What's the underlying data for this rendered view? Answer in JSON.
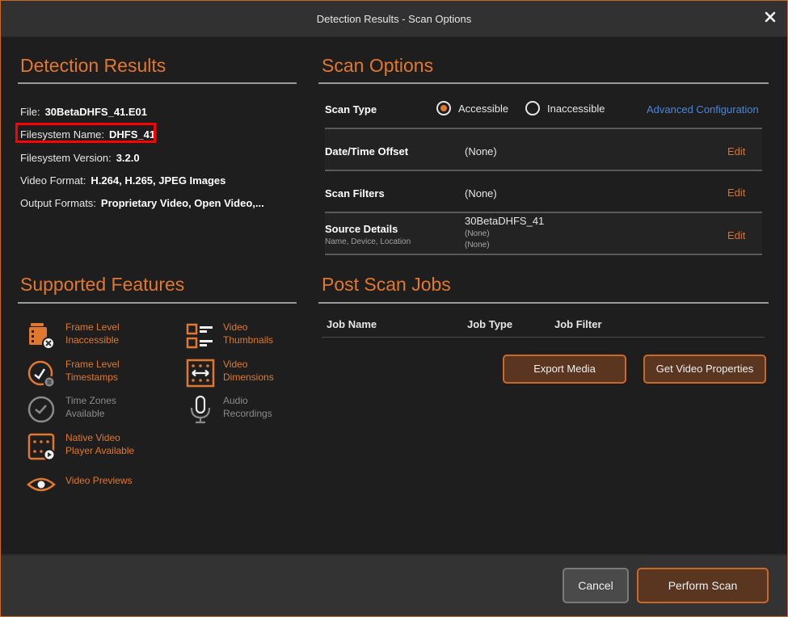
{
  "window": {
    "title": "Detection Results - Scan Options",
    "close_icon": "close-icon"
  },
  "colors": {
    "accent": "#e0782f",
    "link": "#4b86d6",
    "highlight": "#ff0000",
    "button_fill": "#5a3520"
  },
  "detection_results": {
    "title": "Detection Results",
    "fields": [
      {
        "label": "File:",
        "value": "30BetaDHFS_41.E01"
      },
      {
        "label": "Filesystem Name:",
        "value": "DHFS_41"
      },
      {
        "label": "Filesystem Version:",
        "value": "3.2.0"
      },
      {
        "label": "Video Format:",
        "value": "H.264, H.265, JPEG Images"
      },
      {
        "label": "Output Formats:",
        "value": "Proprietary Video, Open Video,..."
      }
    ]
  },
  "supported_features": {
    "title": "Supported Features",
    "items": [
      {
        "line1": "Frame Level",
        "line2": "Inaccessible",
        "icon": "film-inaccessible-icon",
        "enabled": true
      },
      {
        "line1": "Video",
        "line2": "Thumbnails",
        "icon": "thumbnails-icon",
        "enabled": true
      },
      {
        "line1": "Frame Level",
        "line2": "Timestamps",
        "icon": "clock-timestamp-icon",
        "enabled": true
      },
      {
        "line1": "Video",
        "line2": "Dimensions",
        "icon": "dimensions-icon",
        "enabled": true
      },
      {
        "line1": "Time Zones",
        "line2": "Available",
        "icon": "clock-icon",
        "enabled": false
      },
      {
        "line1": "Audio",
        "line2": "Recordings",
        "icon": "microphone-icon",
        "enabled": false
      },
      {
        "line1": "Native Video",
        "line2": "Player Available",
        "icon": "video-player-icon",
        "enabled": true
      },
      {
        "line1": "Video Previews",
        "line2": "",
        "icon": "eye-icon",
        "enabled": true
      }
    ]
  },
  "scan_options": {
    "title": "Scan Options",
    "scan_type": {
      "label": "Scan Type",
      "options": [
        "Accessible",
        "Inaccessible"
      ],
      "selected": "Accessible",
      "advanced_link": "Advanced Configuration"
    },
    "rows": [
      {
        "label": "Date/Time Offset",
        "value": "(None)",
        "action": "Edit"
      },
      {
        "label": "Scan Filters",
        "value": "(None)",
        "action": "Edit"
      },
      {
        "label": "Source Details",
        "sublabel": "Name, Device, Location",
        "value": "30BetaDHFS_41",
        "value2": "(None)",
        "value3": "(None)",
        "action": "Edit"
      }
    ]
  },
  "post_scan_jobs": {
    "title": "Post Scan Jobs",
    "columns": [
      "Job Name",
      "Job Type",
      "Job Filter"
    ],
    "rows": [],
    "buttons": [
      "Export Media",
      "Get Video Properties"
    ]
  },
  "footer": {
    "cancel": "Cancel",
    "perform_scan": "Perform Scan"
  }
}
